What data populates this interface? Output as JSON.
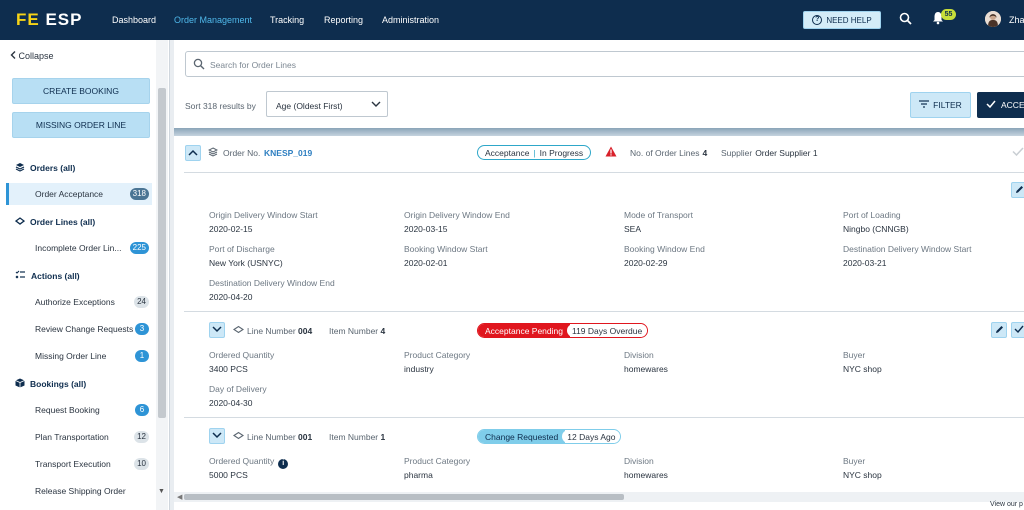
{
  "app": {
    "logo_prefix": "FE",
    "logo_suffix": "ESP"
  },
  "nav": {
    "items": [
      {
        "label": "Dashboard"
      },
      {
        "label": "Order Management"
      },
      {
        "label": "Tracking"
      },
      {
        "label": "Reporting"
      },
      {
        "label": "Administration"
      }
    ],
    "help_label": "NEED HELP",
    "notification_count": "55",
    "user_name": "Zha"
  },
  "sidebar": {
    "collapse_label": "Collapse",
    "create_booking_label": "CREATE BOOKING",
    "missing_order_line_label": "MISSING ORDER LINE",
    "sections": [
      {
        "label": "Orders (all)"
      },
      {
        "label": "Order Lines (all)"
      },
      {
        "label": "Actions (all)"
      },
      {
        "label": "Bookings (all)"
      }
    ],
    "items": [
      {
        "label": "Order Acceptance",
        "count": "318"
      },
      {
        "label": "Incomplete Order Lin...",
        "count": "225"
      },
      {
        "label": "Authorize Exceptions",
        "count": "24"
      },
      {
        "label": "Review Change Requests",
        "count": "3"
      },
      {
        "label": "Missing Order Line",
        "count": "1"
      },
      {
        "label": "Request Booking",
        "count": "6"
      },
      {
        "label": "Plan Transportation",
        "count": "12"
      },
      {
        "label": "Transport Execution",
        "count": "10"
      },
      {
        "label": "Release Shipping Order",
        "count": ""
      }
    ]
  },
  "toolbar": {
    "search_placeholder": "Search for Order Lines",
    "sort_label": "Sort 318 results by",
    "sort_value": "Age (Oldest First)",
    "filter_label": "FILTER",
    "accept_label": "ACCE"
  },
  "order": {
    "order_no_label": "Order No.",
    "order_no": "KNESP_019",
    "status_left": "Acceptance",
    "status_right": "In Progress",
    "order_lines_label": "No. of Order Lines",
    "order_lines_value": "4",
    "supplier_label": "Supplier",
    "supplier_value": "Order Supplier 1",
    "fields": [
      {
        "label": "Origin Delivery Window Start",
        "value": "2020-02-15"
      },
      {
        "label": "Origin Delivery Window End",
        "value": "2020-03-15"
      },
      {
        "label": "Mode of Transport",
        "value": "SEA"
      },
      {
        "label": "Port of Loading",
        "value": "Ningbo (CNNGB)"
      },
      {
        "label": "Port of Discharge",
        "value": "New York (USNYC)"
      },
      {
        "label": "Booking Window Start",
        "value": "2020-02-01"
      },
      {
        "label": "Booking Window End",
        "value": "2020-02-29"
      },
      {
        "label": "Destination Delivery Window Start",
        "value": "2020-03-21"
      },
      {
        "label": "Destination Delivery Window End",
        "value": "2020-04-20"
      }
    ]
  },
  "lines": [
    {
      "line_number_label": "Line Number",
      "line_number": "004",
      "item_number_label": "Item Number",
      "item_number": "4",
      "status": "Acceptance Pending",
      "status_note": "119 Days Overdue",
      "status_color": "#e0161e",
      "fields": [
        {
          "label": "Ordered Quantity",
          "value": "3400 PCS"
        },
        {
          "label": "Product Category",
          "value": "industry"
        },
        {
          "label": "Division",
          "value": "homewares"
        },
        {
          "label": "Buyer",
          "value": "NYC shop"
        },
        {
          "label": "Day of Delivery",
          "value": "2020-04-30"
        }
      ]
    },
    {
      "line_number_label": "Line Number",
      "line_number": "001",
      "item_number_label": "Item Number",
      "item_number": "1",
      "status": "Change Requested",
      "status_note": "12 Days Ago",
      "status_color": "#7fcdea",
      "fields": [
        {
          "label": "Ordered Quantity",
          "value": "5000 PCS"
        },
        {
          "label": "Product Category",
          "value": "pharma"
        },
        {
          "label": "Division",
          "value": "homewares"
        },
        {
          "label": "Buyer",
          "value": "NYC shop"
        }
      ]
    }
  ],
  "footer": {
    "view_our": "View our p"
  }
}
